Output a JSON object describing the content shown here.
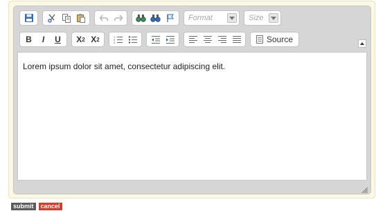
{
  "toolbar": {
    "format_label": "Format",
    "size_label": "Size",
    "bold_label": "B",
    "italic_label": "I",
    "underline_label": "U",
    "subscript_label": "X",
    "subscript_sub": "2",
    "superscript_label": "X",
    "superscript_sup": "2",
    "source_label": "Source"
  },
  "editor": {
    "content": "Lorem ipsum dolor sit amet, consectetur adipiscing elit."
  },
  "actions": {
    "submit_label": "submit",
    "cancel_label": "cancel"
  },
  "colors": {
    "accent_blue": "#2f6fb8",
    "submit_bg": "#5b5b5b",
    "cancel_bg": "#d83a2a"
  }
}
